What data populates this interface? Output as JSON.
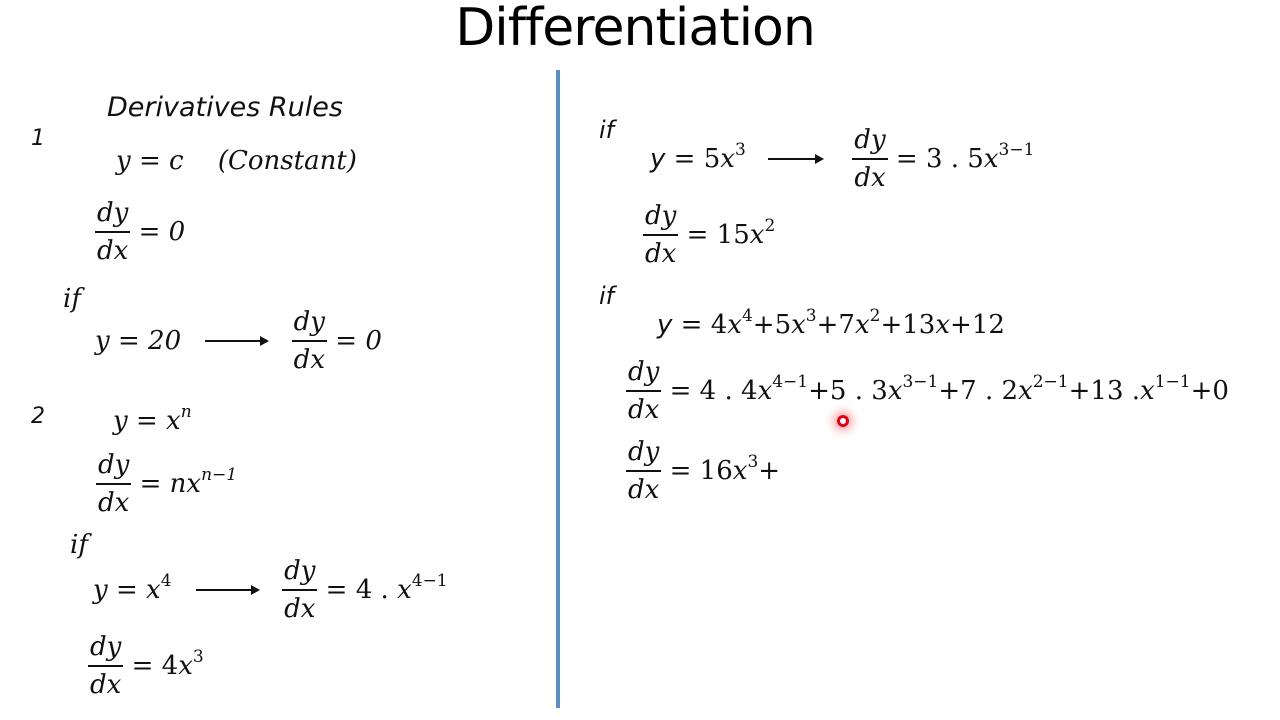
{
  "title": "Differentiation",
  "left": {
    "heading": "Derivatives Rules",
    "rule1": {
      "number": "1",
      "statement": {
        "lhs": "y",
        "eq": "=",
        "rhs": "c",
        "note": "(Constant)"
      },
      "derivative": {
        "num": "dy",
        "den": "dx",
        "eq": "=",
        "rhs": "0"
      },
      "example": {
        "if_label": "if",
        "lhs": "y",
        "eq": "=",
        "rhs": "20",
        "derivative": {
          "num": "dy",
          "den": "dx",
          "eq": "=",
          "rhs": "0"
        }
      }
    },
    "rule2": {
      "number": "2",
      "statement": {
        "lhs": "y",
        "eq": "=",
        "base": "x",
        "exp": "n"
      },
      "derivative": {
        "num": "dy",
        "den": "dx",
        "eq": "=",
        "coef": "n",
        "base": "x",
        "exp": "n−1"
      },
      "example": {
        "if_label": "if",
        "lhs": "y",
        "eq": "=",
        "base": "x",
        "exp": "4",
        "derivative": {
          "num": "dy",
          "den": "dx",
          "eq": "=",
          "coef": "4 .",
          "base": "x",
          "exp": "4−1"
        },
        "result": {
          "num": "dy",
          "den": "dx",
          "eq": "=",
          "coef": "4",
          "base": "x",
          "exp": "3"
        }
      }
    }
  },
  "right": {
    "example1": {
      "if_label": "if",
      "lhs": "y",
      "eq": "=",
      "coef": "5",
      "base": "x",
      "exp": "3",
      "derivative": {
        "num": "dy",
        "den": "dx",
        "eq": "=",
        "coef": "3 . 5",
        "base": "x",
        "exp": "3−1"
      },
      "result": {
        "num": "dy",
        "den": "dx",
        "eq": "=",
        "coef": "15",
        "base": "x",
        "exp": "2"
      }
    },
    "example2": {
      "if_label": "if",
      "lhs": "y",
      "eq": "=",
      "terms": [
        {
          "coef": "4",
          "base": "x",
          "exp": "4",
          "op": "+"
        },
        {
          "coef": "5",
          "base": "x",
          "exp": "3",
          "op": "+"
        },
        {
          "coef": "7",
          "base": "x",
          "exp": "2",
          "op": "+"
        },
        {
          "coef": "13",
          "base": "x",
          "exp": "",
          "op": "+"
        },
        {
          "coef": "12",
          "base": "",
          "exp": "",
          "op": ""
        }
      ],
      "derivative": {
        "num": "dy",
        "den": "dx",
        "eq": "=",
        "terms": [
          {
            "coef": "4 . 4",
            "base": "x",
            "exp": "4−1",
            "op": "+"
          },
          {
            "coef": "5 . 3",
            "base": "x",
            "exp": "3−1",
            "op": "+"
          },
          {
            "coef": "7 . 2",
            "base": "x",
            "exp": "2−1",
            "op": "+"
          },
          {
            "coef": "13 .",
            "base": "x",
            "exp": "1−1",
            "op": "+"
          },
          {
            "coef": "0",
            "base": "",
            "exp": "",
            "op": ""
          }
        ]
      },
      "partial_result": {
        "num": "dy",
        "den": "dx",
        "eq": "=",
        "coef": "16",
        "base": "x",
        "exp": "3",
        "trail": "+"
      }
    }
  },
  "colors": {
    "divider": "#5b8fbf",
    "cursor": "#e60012",
    "text": "#111111"
  }
}
